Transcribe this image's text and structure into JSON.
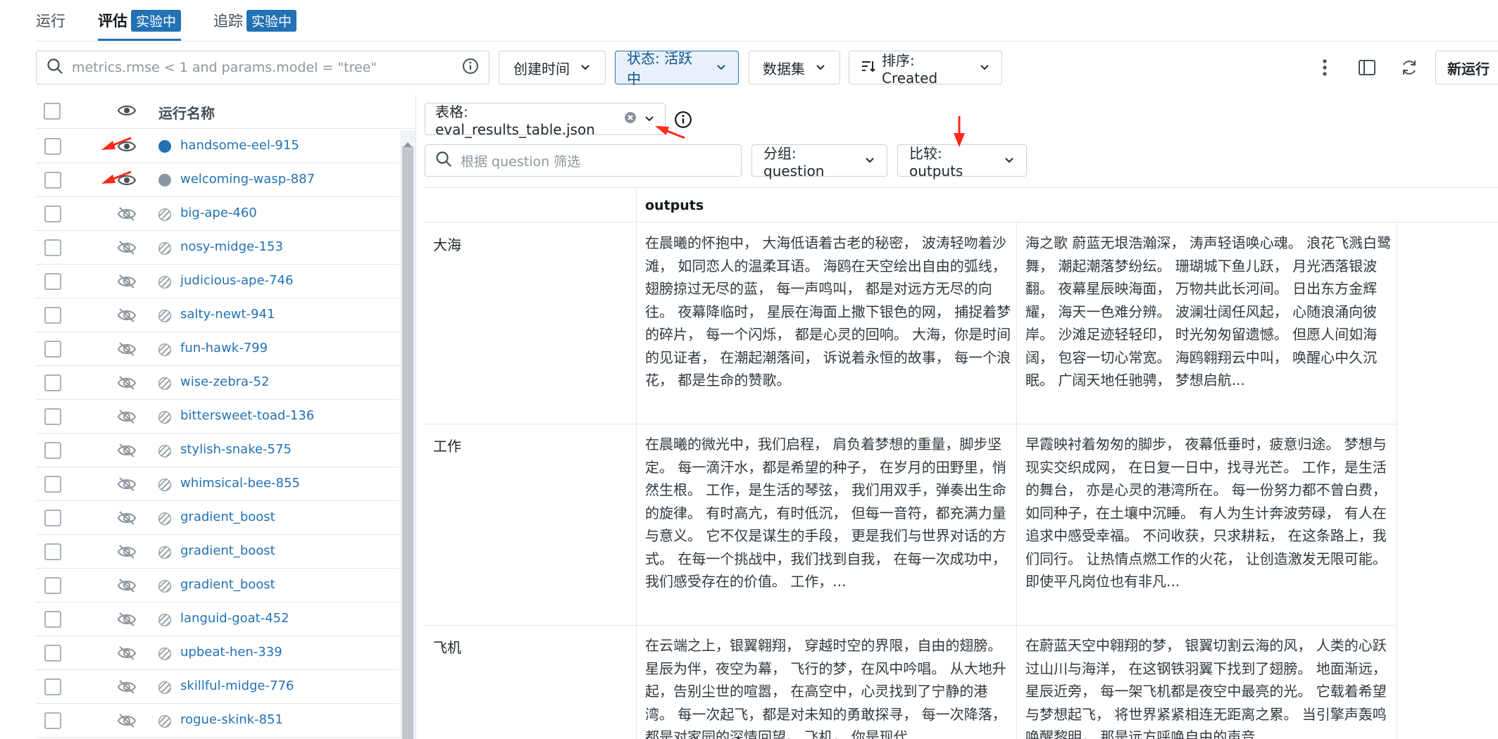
{
  "tabs": [
    {
      "label": "运行",
      "badge": ""
    },
    {
      "label": "评估",
      "badge": "实验中"
    },
    {
      "label": "追踪",
      "badge": "实验中"
    }
  ],
  "filter": {
    "search_placeholder": "metrics.rmse < 1 and params.model = \"tree\"",
    "created_time": "创建时间",
    "status": "状态: 活跃中",
    "dataset": "数据集",
    "sort": "排序: Created",
    "new_run": "新运行"
  },
  "runs_table": {
    "header": "运行名称",
    "rows": [
      {
        "name": "handsome-eel-915",
        "visible": true,
        "color": "#2272b4"
      },
      {
        "name": "welcoming-wasp-887",
        "visible": true,
        "color": "#8a96a3"
      },
      {
        "name": "big-ape-460",
        "visible": false,
        "color": ""
      },
      {
        "name": "nosy-midge-153",
        "visible": false,
        "color": ""
      },
      {
        "name": "judicious-ape-746",
        "visible": false,
        "color": ""
      },
      {
        "name": "salty-newt-941",
        "visible": false,
        "color": ""
      },
      {
        "name": "fun-hawk-799",
        "visible": false,
        "color": ""
      },
      {
        "name": "wise-zebra-52",
        "visible": false,
        "color": ""
      },
      {
        "name": "bittersweet-toad-136",
        "visible": false,
        "color": ""
      },
      {
        "name": "stylish-snake-575",
        "visible": false,
        "color": ""
      },
      {
        "name": "whimsical-bee-855",
        "visible": false,
        "color": ""
      },
      {
        "name": "gradient_boost",
        "visible": false,
        "color": ""
      },
      {
        "name": "gradient_boost",
        "visible": false,
        "color": ""
      },
      {
        "name": "gradient_boost",
        "visible": false,
        "color": ""
      },
      {
        "name": "languid-goat-452",
        "visible": false,
        "color": ""
      },
      {
        "name": "upbeat-hen-339",
        "visible": false,
        "color": ""
      },
      {
        "name": "skillful-midge-776",
        "visible": false,
        "color": ""
      },
      {
        "name": "rogue-skink-851",
        "visible": false,
        "color": ""
      }
    ]
  },
  "eval_panel": {
    "table_select": "表格: eval_results_table.json",
    "filter_placeholder": "根据 question 筛选",
    "group_by": "分组: question",
    "compare": "比较: outputs",
    "column_header": "outputs",
    "groups": [
      {
        "label": "大海",
        "cells": [
          "在晨曦的怀抱中， 大海低语着古老的秘密， 波涛轻吻着沙滩， 如同恋人的温柔耳语。 海鸥在天空绘出自由的弧线， 翅膀掠过无尽的蓝， 每一声鸣叫， 都是对远方无尽的向往。 夜幕降临时， 星辰在海面上撒下银色的网， 捕捉着梦的碎片， 每一个闪烁， 都是心灵的回响。 大海，你是时间的见证者， 在潮起潮落间， 诉说着永恒的故事， 每一个浪花， 都是生命的赞歌。",
          "海之歌 蔚蓝无垠浩瀚深， 涛声轻语唤心魂。 浪花飞溅白鹭舞， 潮起潮落梦纷纭。 珊瑚城下鱼儿跃， 月光洒落银波翻。 夜幕星辰映海面， 万物共此长河间。 日出东方金辉耀， 海天一色难分辨。 波澜壮阔任风起， 心随浪涌向彼岸。 沙滩足迹轻轻印， 时光匆匆留遗憾。 但愿人间如海阔， 包容一切心常宽。 海鸥翱翔云中叫， 唤醒心中久沉眠。 广阔天地任驰骋， 梦想启航..."
        ]
      },
      {
        "label": "工作",
        "cells": [
          "在晨曦的微光中，我们启程， 肩负着梦想的重量，脚步坚定。 每一滴汗水，都是希望的种子， 在岁月的田野里，悄然生根。 工作，是生活的琴弦， 我们用双手，弹奏出生命的旋律。 有时高亢，有时低沉， 但每一音符，都充满力量与意义。 它不仅是谋生的手段， 更是我们与世界对话的方式。 在每一个挑战中，我们找到自我， 在每一次成功中，我们感受存在的价值。 工作，...",
          "早霞映衬着匆匆的脚步， 夜幕低垂时，疲意归途。 梦想与现实交织成网， 在日复一日中，找寻光芒。 工作，是生活的舞台， 亦是心灵的港湾所在。 每一份努力都不曾白费， 如同种子，在土壤中沉睡。 有人为生计奔波劳碌， 有人在追求中感受幸福。 不问收获，只求耕耘， 在这条路上，我们同行。 让热情点燃工作的火花， 让创造激发无限可能。 即使平凡岗位也有非凡..."
        ]
      },
      {
        "label": "飞机",
        "cells": [
          "在云端之上，银翼翱翔， 穿越时空的界限，自由的翅膀。 星辰为伴，夜空为幕， 飞行的梦，在风中吟唱。 从大地升起，告别尘世的喧嚣， 在高空中，心灵找到了宁静的港湾。 每一次起飞，都是对未知的勇敢探寻， 每一次降落，都是对家园的深情回望。 飞机， 你是现代...",
          "在蔚蓝天空中翱翔的梦， 银翼切割云海的风， 人类的心跃过山川与海洋， 在这钢铁羽翼下找到了翅膀。 地面渐远，星辰近旁， 每一架飞机都是夜空中最亮的光。 它载着希望与梦想起飞， 将世界紧紧相连无距离之累。 当引擎声轰鸣唤醒黎明， 那是远方呼唤自由的声音..."
        ]
      }
    ]
  }
}
